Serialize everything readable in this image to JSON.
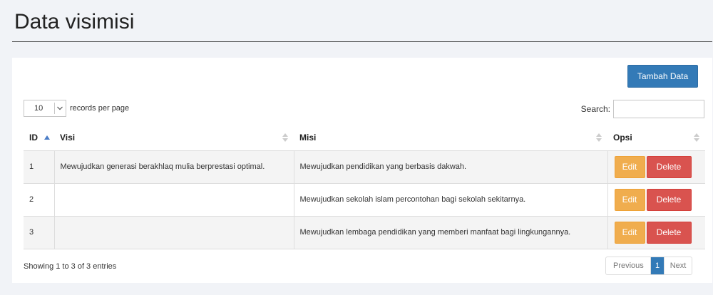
{
  "page": {
    "title": "Data visimisi"
  },
  "toolbar": {
    "add_label": "Tambah Data"
  },
  "length": {
    "value": "10",
    "label": "records per page"
  },
  "search": {
    "label": "Search:",
    "value": ""
  },
  "table": {
    "headers": {
      "id": "ID",
      "visi": "Visi",
      "misi": "Misi",
      "opsi": "Opsi"
    },
    "sort": {
      "column": "ID",
      "direction": "ascending"
    },
    "rows": [
      {
        "id": "1",
        "visi": "Mewujudkan generasi berakhlaq mulia berprestasi optimal.",
        "misi": "Mewujudkan pendidikan yang berbasis dakwah.",
        "edit": "Edit",
        "delete": "Delete"
      },
      {
        "id": "2",
        "visi": "",
        "misi": "Mewujudkan sekolah islam percontohan bagi sekolah sekitarnya.",
        "edit": "Edit",
        "delete": "Delete"
      },
      {
        "id": "3",
        "visi": "",
        "misi": "Mewujudkan lembaga pendidikan yang memberi manfaat bagi lingkungannya.",
        "edit": "Edit",
        "delete": "Delete"
      }
    ]
  },
  "footer": {
    "info": "Showing 1 to 3 of 3 entries"
  },
  "pagination": {
    "previous": "Previous",
    "current": "1",
    "next": "Next"
  },
  "colors": {
    "primary": "#337ab7",
    "warning": "#f0ad4e",
    "danger": "#d9534f",
    "background": "#f1f3f7"
  },
  "icons": {
    "sort_asc": "sort-ascending-icon",
    "sort_both": "sort-both-icon",
    "select_arrow": "chevron-down-icon"
  }
}
